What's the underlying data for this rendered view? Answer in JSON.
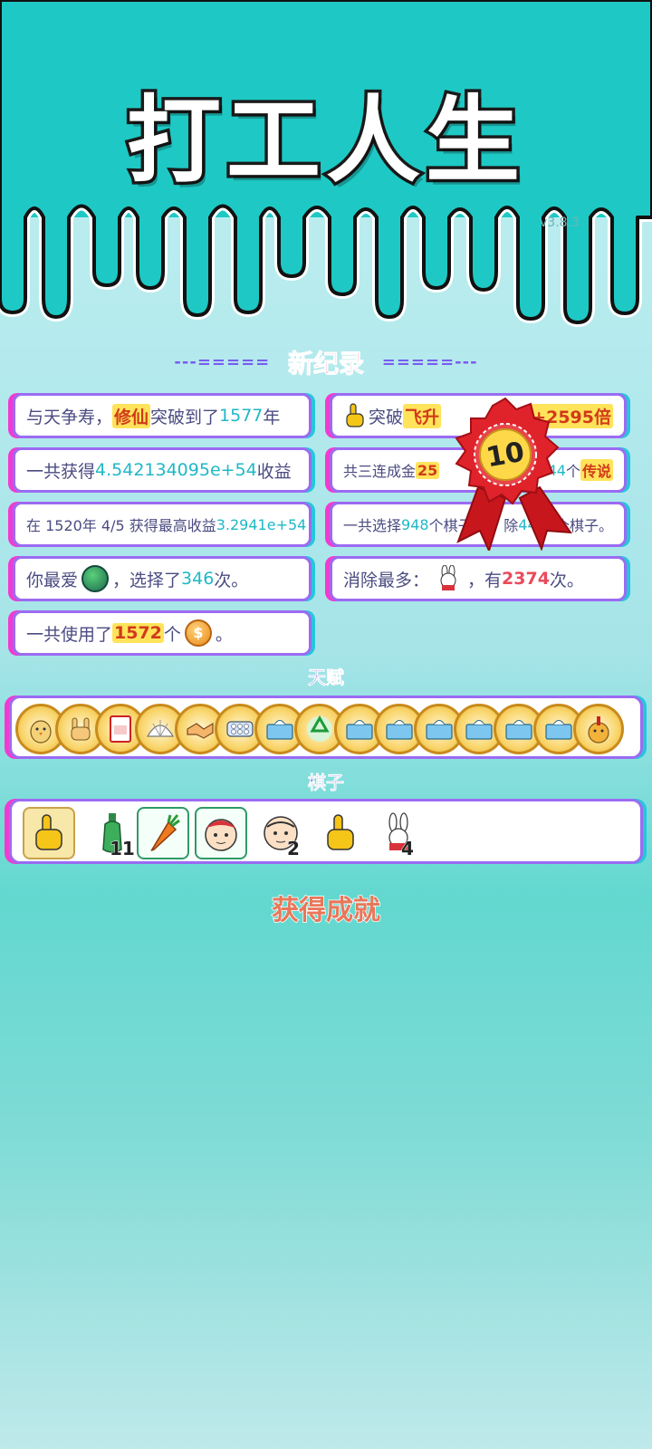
{
  "header": {
    "title": "打工人生",
    "version": "v3.8.3",
    "bg_color": "#1ec9c5"
  },
  "new_record": {
    "title": "新纪录",
    "dash_left": "---=====",
    "dash_right": "=====---"
  },
  "stats": {
    "row1_left": {
      "prefix": "与天争寿，",
      "tag": "修仙",
      "mid": "突破到了",
      "value": "1577",
      "suffix": "年"
    },
    "row1_right": {
      "prefix": "突破",
      "tag": "飞升",
      "value": "+2595倍"
    },
    "row2_left": {
      "prefix": "一共获得",
      "value": "4.542134095e+54",
      "suffix": "收益"
    },
    "row2_right": {
      "prefix": "共三连成金",
      "value": "25",
      "value2": "44",
      "mid": "个",
      "tag": "传说"
    },
    "row3_left": {
      "prefix": "在 1520年 4/5 获得最高收益",
      "value": "3.2941e+54"
    },
    "row3_right": {
      "prefix": "一共选择",
      "value": "948",
      "mid": "个棋子，",
      "mid2": "除",
      "value2": "4426",
      "suffix": "个棋子。"
    },
    "row4_left": {
      "prefix": "你最爱",
      "mid": "，选择了",
      "value": "346",
      "suffix": "次。"
    },
    "row4_right": {
      "prefix": "消除最多：",
      "mid": "，有",
      "value": "2374",
      "suffix": "次。"
    },
    "row5_left": {
      "prefix": "一共使用了",
      "value": "1572",
      "mid": "个",
      "coin": "$",
      "suffix": "。"
    }
  },
  "badge": {
    "value": "10",
    "icon": "red-rosette-badge"
  },
  "talents": {
    "label": "天赋",
    "items": [
      {
        "icon": "chick-icon"
      },
      {
        "icon": "rock-hand-icon"
      },
      {
        "icon": "time-card-icon"
      },
      {
        "icon": "shell-icon"
      },
      {
        "icon": "handshake-icon"
      },
      {
        "icon": "pill-board-icon"
      },
      {
        "icon": "tissue-box-icon"
      },
      {
        "icon": "recycle-icon"
      },
      {
        "icon": "tissue-box-icon"
      },
      {
        "icon": "tissue-box-icon"
      },
      {
        "icon": "tissue-box-icon"
      },
      {
        "icon": "tissue-box-icon"
      },
      {
        "icon": "tissue-box-icon"
      },
      {
        "icon": "tissue-box-icon"
      },
      {
        "icon": "chick-hat-icon"
      }
    ]
  },
  "pieces": {
    "label": "棋子",
    "items": [
      {
        "icon": "pointing-finger-icon",
        "count": ""
      },
      {
        "icon": "green-bottle-icon",
        "count": "11"
      },
      {
        "icon": "carrot-icon",
        "count": ""
      },
      {
        "icon": "red-hair-face-icon",
        "count": ""
      },
      {
        "icon": "bald-face-icon",
        "count": "2"
      },
      {
        "icon": "pointing-finger-icon",
        "count": ""
      },
      {
        "icon": "rabbit-icon",
        "count": "4"
      }
    ]
  },
  "achievements": {
    "title": "获得成就"
  }
}
